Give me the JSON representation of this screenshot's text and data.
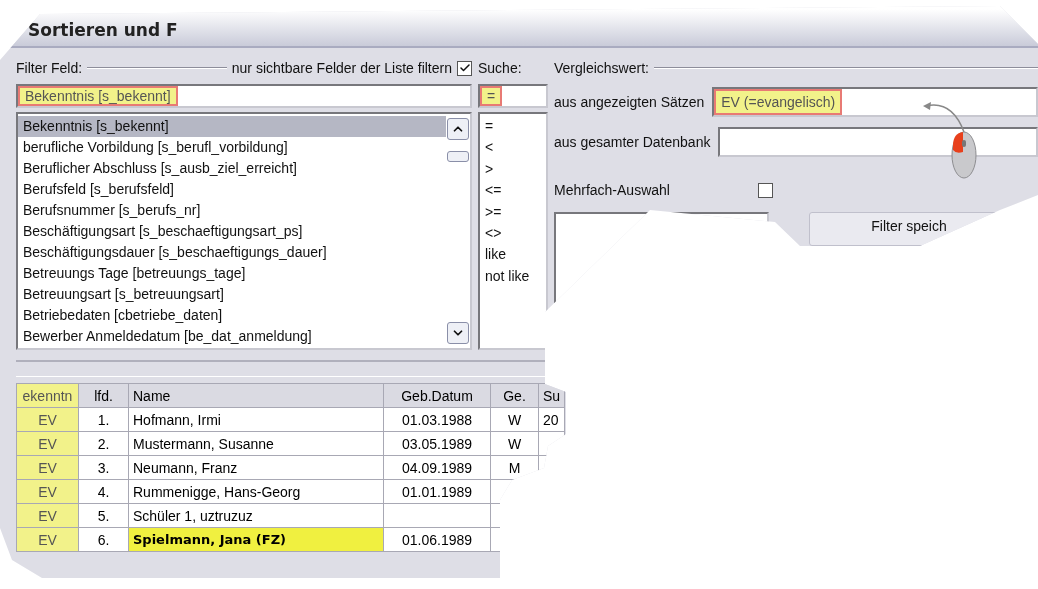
{
  "window": {
    "title": "Sortieren und F"
  },
  "filter_field": {
    "label": "Filter Feld:",
    "visible_only": {
      "label": "nur sichtbare Felder der Liste filtern",
      "checked": true
    },
    "value": "Bekenntnis [s_bekennt]",
    "highlighted": true,
    "items": [
      {
        "label": "Bekenntnis [s_bekennt]",
        "selected": true
      },
      {
        "label": "berufliche Vorbildung [s_berufl_vorbildung]",
        "selected": false
      },
      {
        "label": "Beruflicher Abschluss [s_ausb_ziel_erreicht]",
        "selected": false
      },
      {
        "label": "Berufsfeld [s_berufsfeld]",
        "selected": false
      },
      {
        "label": "Berufsnummer [s_berufs_nr]",
        "selected": false
      },
      {
        "label": "Beschäftigungsart [s_beschaeftigungsart_ps]",
        "selected": false
      },
      {
        "label": "Beschäftigungsdauer [s_beschaeftigungs_dauer]",
        "selected": false
      },
      {
        "label": "Betreuungs Tage [betreuungs_tage]",
        "selected": false
      },
      {
        "label": "Betreuungsart [s_betreuungsart]",
        "selected": false
      },
      {
        "label": "Betriebedaten [cbetriebe_daten]",
        "selected": false
      },
      {
        "label": "Bewerber Anmeldedatum [be_dat_anmeldung]",
        "selected": false
      }
    ]
  },
  "search": {
    "label": "Suche:",
    "value": "=",
    "highlighted": true,
    "operators": [
      "=",
      "<",
      ">",
      "<=",
      ">=",
      "<>",
      "like",
      "not like"
    ]
  },
  "compare": {
    "label": "Vergleichswert:",
    "shown_records": {
      "label": "aus angezeigten Sätzen",
      "value": "EV (=evangelisch)",
      "highlighted": true
    },
    "whole_database": {
      "label": "aus gesamter Datenbank"
    },
    "multi_select": {
      "label": "Mehrfach-Auswahl",
      "checked": false
    },
    "save_button": "Filter speich"
  },
  "table": {
    "columns": [
      {
        "label": "ekenntn",
        "highlighted": true
      },
      {
        "label": "lfd.",
        "highlighted": false
      },
      {
        "label": "Name",
        "highlighted": false
      },
      {
        "label": "Geb.Datum",
        "highlighted": false
      },
      {
        "label": "Ge.",
        "highlighted": false
      },
      {
        "label": "Su",
        "highlighted": false
      }
    ],
    "rows": [
      {
        "cells": [
          "EV",
          "1.",
          "Hofmann, Irmi",
          "01.03.1988",
          "W",
          "20"
        ],
        "marked": false
      },
      {
        "cells": [
          "EV",
          "2.",
          "Mustermann, Susanne",
          "03.05.1989",
          "W"
        ],
        "marked": false
      },
      {
        "cells": [
          "EV",
          "3.",
          "Neumann, Franz",
          "04.09.1989",
          "M"
        ],
        "marked": false
      },
      {
        "cells": [
          "EV",
          "4.",
          "Rummenigge, Hans-Georg",
          "01.01.1989"
        ],
        "marked": false
      },
      {
        "cells": [
          "EV",
          "5.",
          "Schüler 1, uztruzuz"
        ],
        "marked": false
      },
      {
        "cells": [
          "EV",
          "6.",
          "Spielmann, Jana (FZ)",
          "01.06.1989"
        ],
        "marked": true
      }
    ]
  }
}
